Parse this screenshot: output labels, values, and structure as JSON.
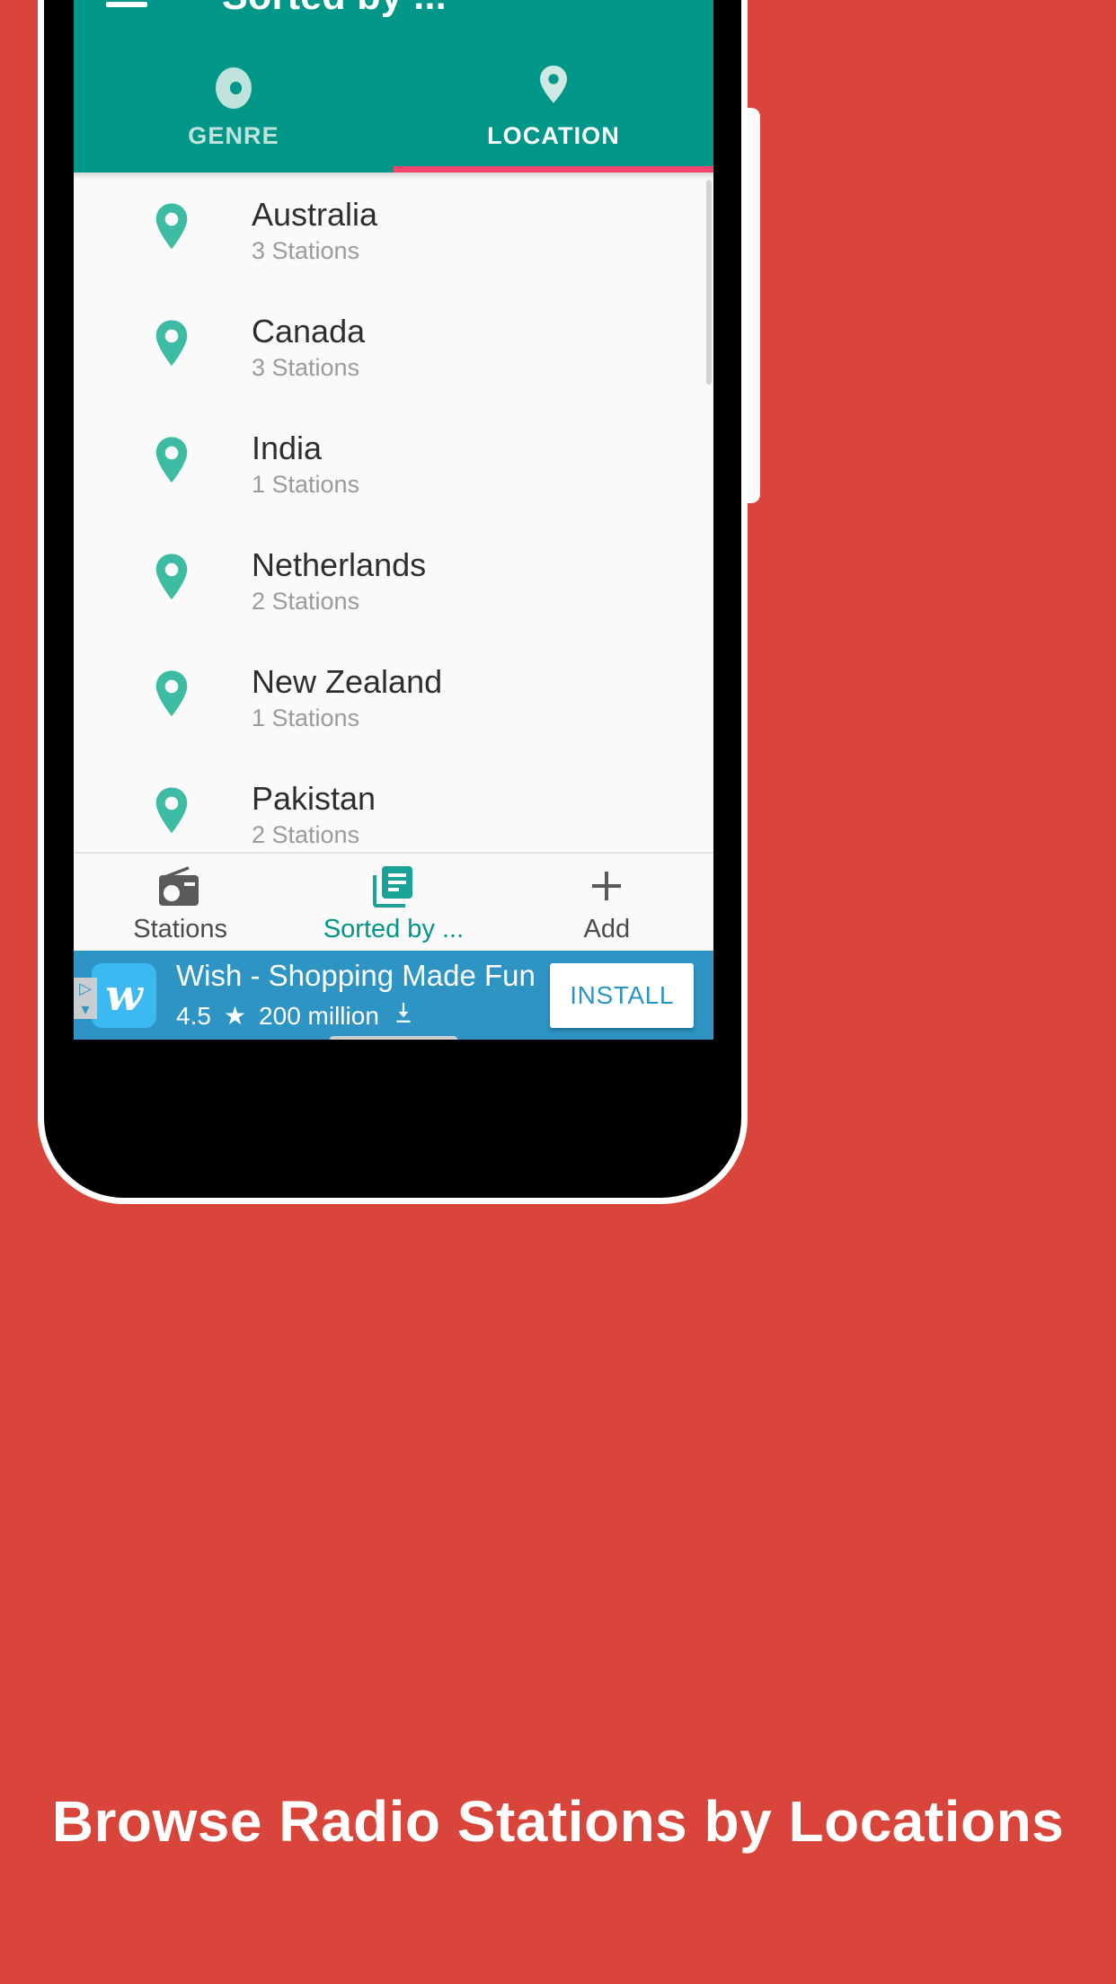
{
  "appbar": {
    "title": "Sorted by ...",
    "menu_icon": "hamburger-icon"
  },
  "tabs": [
    {
      "label": "GENRE",
      "icon": "record-disc-icon",
      "active": false
    },
    {
      "label": "LOCATION",
      "icon": "location-pin-icon",
      "active": true
    }
  ],
  "list": {
    "items": [
      {
        "name": "Australia",
        "stations": "3 Stations"
      },
      {
        "name": "Canada",
        "stations": "3 Stations"
      },
      {
        "name": "India",
        "stations": "1 Stations"
      },
      {
        "name": "Netherlands",
        "stations": "2 Stations"
      },
      {
        "name": "New Zealand",
        "stations": "1 Stations"
      },
      {
        "name": "Pakistan",
        "stations": "2 Stations"
      }
    ]
  },
  "bottom_nav": [
    {
      "label": "Stations",
      "icon": "radio-icon",
      "active": false
    },
    {
      "label": "Sorted by ...",
      "icon": "library-books-icon",
      "active": true
    },
    {
      "label": "Add",
      "icon": "plus-icon",
      "active": false
    }
  ],
  "ad": {
    "logo_letter": "w",
    "title": "Wish - Shopping Made Fun",
    "rating": "4.5",
    "star_icon": "star-icon",
    "downloads": "200 million",
    "download_icon": "download-icon",
    "install_label": "INSTALL",
    "adchoices_icons": [
      "info-triangle-icon",
      "chevron-down-icon"
    ]
  },
  "caption": "Browse Radio Stations by Locations",
  "colors": {
    "accent_teal": "#009688",
    "pin_teal": "#3ebca3",
    "tab_indicator_pink": "#f4436c",
    "poster_red": "#d9453a",
    "ad_blue": "#2d94c4"
  }
}
